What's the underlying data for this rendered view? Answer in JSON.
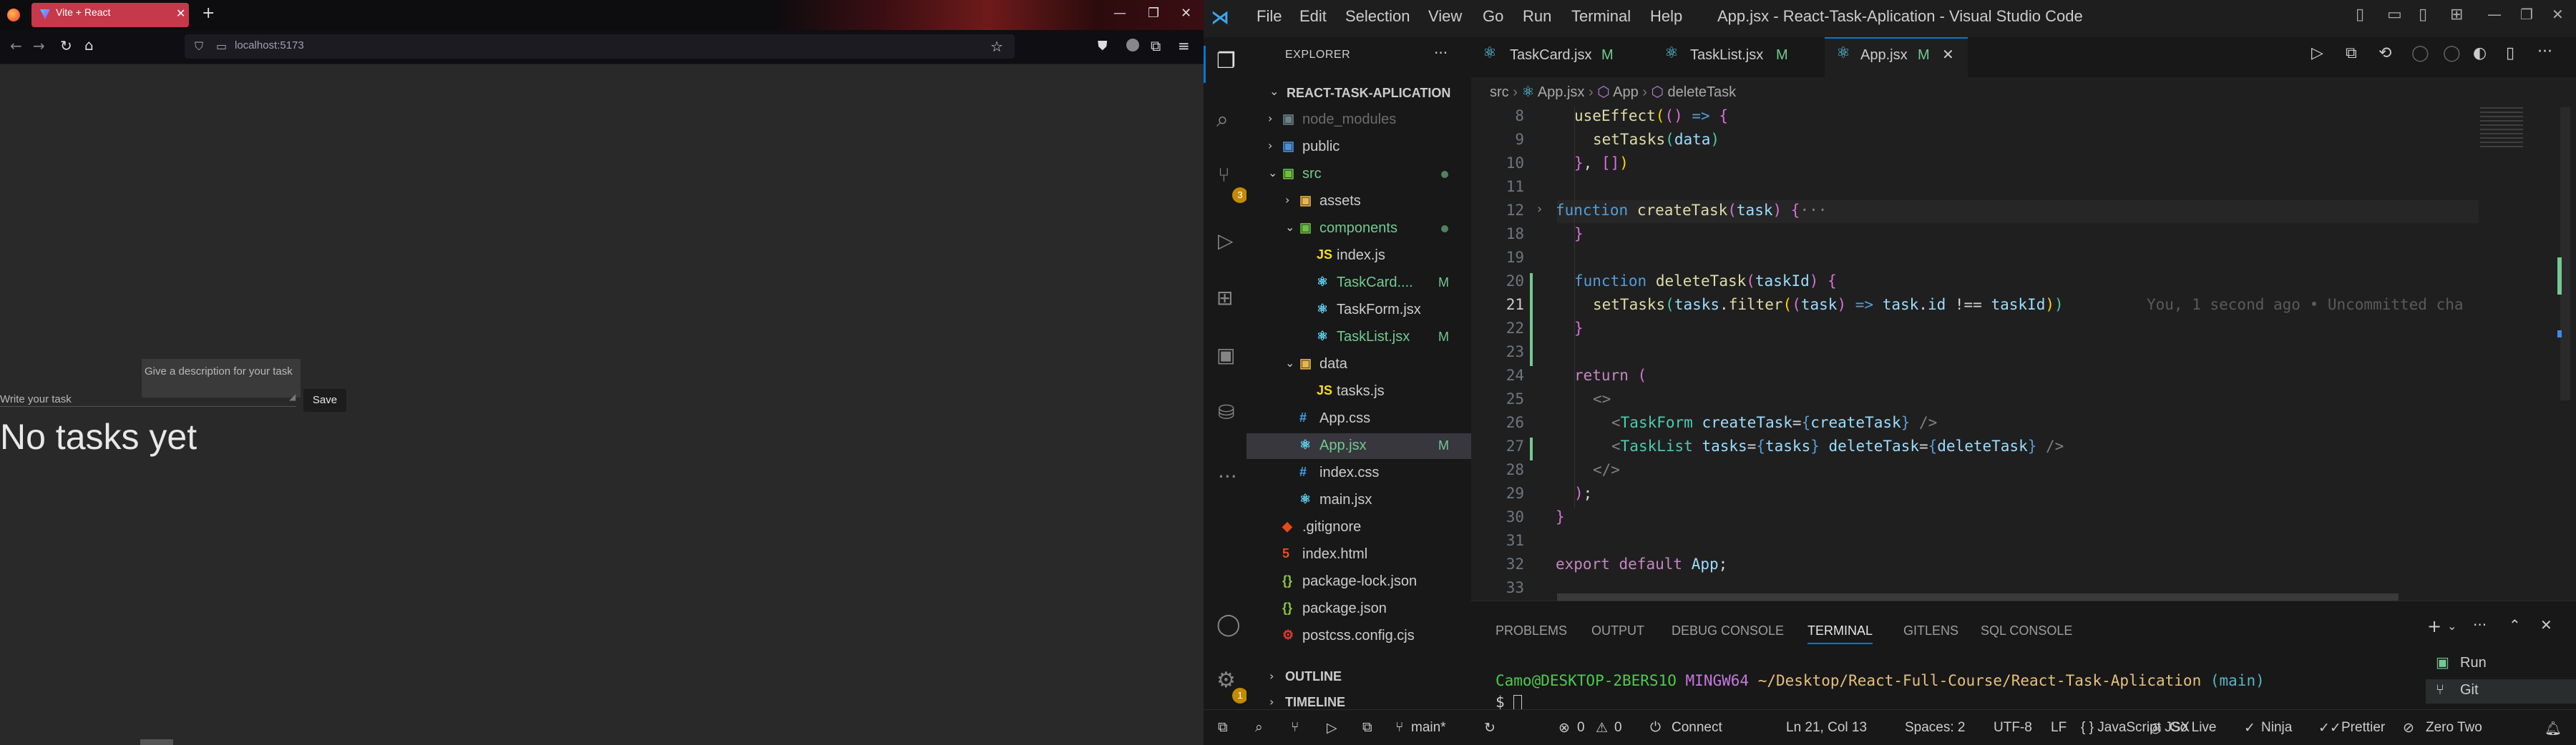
{
  "browser": {
    "tab_title": "Vite + React",
    "url": "localhost:5173"
  },
  "app": {
    "description_placeholder": "Give a description for your task",
    "task_placeholder": "Write your task",
    "save_label": "Save",
    "empty_message": "No tasks yet"
  },
  "vscode": {
    "menu": [
      "File",
      "Edit",
      "Selection",
      "View",
      "Go",
      "Run",
      "Terminal",
      "Help"
    ],
    "window_title": "App.jsx - React-Task-Aplication - Visual Studio Code",
    "explorer_label": "EXPLORER",
    "project": "REACT-TASK-APLICATION",
    "tree": [
      {
        "name": "node_modules",
        "status": ""
      },
      {
        "name": "public",
        "status": ""
      },
      {
        "name": "src",
        "status": "dot"
      },
      {
        "name": "assets",
        "status": ""
      },
      {
        "name": "components",
        "status": "dot"
      },
      {
        "name": "index.js",
        "status": ""
      },
      {
        "name": "TaskCard....",
        "status": "M"
      },
      {
        "name": "TaskForm.jsx",
        "status": ""
      },
      {
        "name": "TaskList.jsx",
        "status": "M"
      },
      {
        "name": "data",
        "status": ""
      },
      {
        "name": "tasks.js",
        "status": ""
      },
      {
        "name": "App.css",
        "status": ""
      },
      {
        "name": "App.jsx",
        "status": "M"
      },
      {
        "name": "index.css",
        "status": ""
      },
      {
        "name": "main.jsx",
        "status": ""
      },
      {
        "name": ".gitignore",
        "status": ""
      },
      {
        "name": "index.html",
        "status": ""
      },
      {
        "name": "package-lock.json",
        "status": ""
      },
      {
        "name": "package.json",
        "status": ""
      },
      {
        "name": "postcss.config.cjs",
        "status": ""
      }
    ],
    "outline": "OUTLINE",
    "timeline": "TIMELINE",
    "scm_badge": "3",
    "settings_badge": "1",
    "tabs": [
      {
        "name": "TaskCard.jsx",
        "status": "M"
      },
      {
        "name": "TaskList.jsx",
        "status": "M"
      },
      {
        "name": "App.jsx",
        "status": "M"
      }
    ],
    "breadcrumb": [
      "src",
      "App.jsx",
      "App",
      "deleteTask"
    ],
    "line_numbers": [
      "8",
      "9",
      "10",
      "11",
      "12",
      "18",
      "19",
      "20",
      "21",
      "22",
      "23",
      "24",
      "25",
      "26",
      "27",
      "28",
      "29",
      "30",
      "31",
      "32",
      "33"
    ],
    "blame": "You, 1 second ago • Uncommitted cha",
    "panel_tabs": [
      "PROBLEMS",
      "OUTPUT",
      "DEBUG CONSOLE",
      "TERMINAL",
      "GITLENS",
      "SQL CONSOLE"
    ],
    "terminal": {
      "user": "Camo@DESKTOP-2BERS1O",
      "shell": "MINGW64",
      "path": "~/Desktop/React-Full-Course/React-Task-Aplication",
      "branch": "(main)",
      "prompt": "$"
    },
    "terminal_list": [
      "Run",
      "Git"
    ],
    "status": {
      "branch": "main*",
      "errors": "0",
      "warnings": "0",
      "connect": "Connect",
      "position": "Ln 21, Col 13",
      "spaces": "Spaces: 2",
      "encoding": "UTF-8",
      "eol": "LF",
      "language": "{ } JavaScript JSX",
      "golive": "Go Live",
      "ninja": "Ninja",
      "prettier": "Prettier",
      "theme": "Zero Two"
    },
    "colors": {
      "accent": "#0078d4",
      "modified": "#73c991",
      "firefox_tab": "#c5394a"
    }
  }
}
